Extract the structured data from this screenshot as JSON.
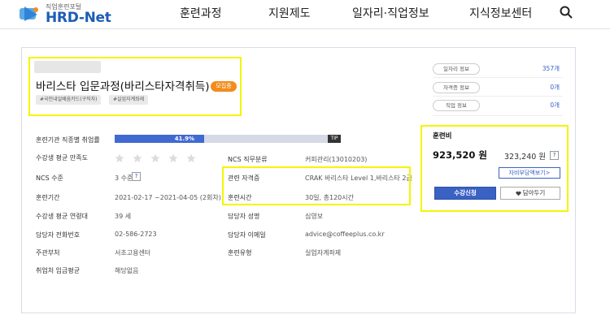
{
  "header": {
    "logo_sub": "직업훈련포털",
    "logo_text": "HRD-Net",
    "nav": [
      {
        "label": "훈련과정"
      },
      {
        "label": "지원제도"
      },
      {
        "label": "일자리·직업정보"
      },
      {
        "label": "지식정보센터"
      }
    ],
    "search_icon": "search-icon"
  },
  "course": {
    "title": "바리스타 입문과정(바리스타자격취득)",
    "badge": "모집중",
    "tags": [
      "#국민내일배움카드(구직자)",
      "#실업자계좌제"
    ]
  },
  "side_info": [
    {
      "label": "일자리 정보",
      "count": "357개"
    },
    {
      "label": "자격증 정보",
      "count": "0개"
    },
    {
      "label": "직업 정보",
      "count": "0개"
    }
  ],
  "fee": {
    "title": "훈련비",
    "total": "923,520 원",
    "self_pay": "323,240 원",
    "help": "?",
    "self_pay_button": "자비부담액보기>",
    "apply_button": "수강신청",
    "wish_button": "담아두기"
  },
  "details": {
    "employment_rate_label": "훈련기관 직종별 취업률",
    "employment_rate_value": "41.9%",
    "employment_rate": 0.419,
    "tip": "TIP",
    "satisfaction_label": "수강생 평균 만족도",
    "satisfaction_stars": 0,
    "ncs_job_label": "NCS 직무분류",
    "ncs_job_value": "커피관리(13010203)",
    "ncs_level_label": "NCS 수준",
    "ncs_level_value": "3 수준",
    "ncs_level_help": "?",
    "cert_label": "관련 자격증",
    "cert_value": "CRAK 바리스타 Level 1,바리스타 2급",
    "period_label": "훈련기간",
    "period_value": "2021-02-17 ~2021-04-05 (2회차)",
    "hours_label": "훈련시간",
    "hours_value": "30일, 총120시간",
    "age_label": "수강생 평균 연령대",
    "age_value": "39 세",
    "manager_label": "담당자 성명",
    "manager_value": "심영보",
    "phone_label": "담당자 전화번호",
    "phone_value": "02-586-2723",
    "email_label": "담당자 이메일",
    "email_value": "advice@coffeeplus.co.kr",
    "dept_label": "주관부처",
    "dept_value": "서초고용센터",
    "type_label": "훈련유형",
    "type_value": "실업자계좌제",
    "wage_label": "취업처 임금평균",
    "wage_value": "해당없음"
  },
  "colors": {
    "brand": "#1d5db5",
    "accent": "#4169d2",
    "badge": "#f28c1e",
    "highlight": "#f5f500"
  }
}
